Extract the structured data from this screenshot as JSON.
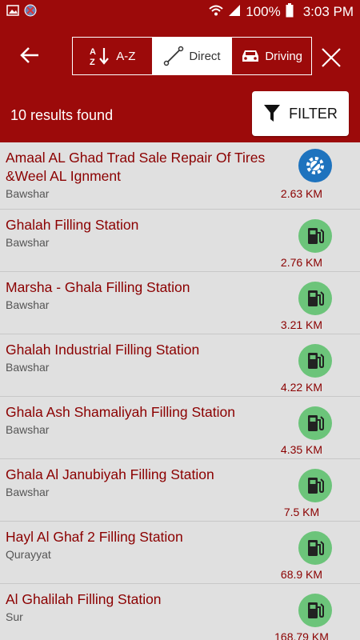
{
  "status_bar": {
    "battery": "100%",
    "time": "3:03 PM"
  },
  "toolbar": {
    "sort_options": [
      {
        "label": "A-Z",
        "icon": "sort-az-icon"
      },
      {
        "label": "Direct",
        "icon": "direct-line-icon"
      },
      {
        "label": "Driving",
        "icon": "car-icon"
      }
    ],
    "active_sort": "Direct"
  },
  "results": {
    "count_text": "10 results found",
    "filter_label": "FILTER"
  },
  "colors": {
    "brand": "#9c0a0a",
    "service_icon": "#1e73be",
    "fuel_icon": "#6cc47a",
    "name_text": "#8b0000"
  },
  "list": [
    {
      "name": "Amaal AL Ghad Trad Sale Repair Of Tires &Weel  AL Ignment",
      "area": "Bawshar",
      "distance": "2.63 KM",
      "icon": "service-gear-icon"
    },
    {
      "name": "Ghalah Filling Station",
      "area": "Bawshar",
      "distance": "2.76 KM",
      "icon": "fuel-pump-icon"
    },
    {
      "name": "Marsha - Ghala Filling Station",
      "area": "Bawshar",
      "distance": "3.21 KM",
      "icon": "fuel-pump-icon"
    },
    {
      "name": "Ghalah Industrial Filling Station",
      "area": "Bawshar",
      "distance": "4.22 KM",
      "icon": "fuel-pump-icon"
    },
    {
      "name": "Ghala Ash Shamaliyah Filling Station",
      "area": "Bawshar",
      "distance": "4.35 KM",
      "icon": "fuel-pump-icon"
    },
    {
      "name": "Ghala Al Janubiyah Filling Station",
      "area": "Bawshar",
      "distance": "7.5 KM",
      "icon": "fuel-pump-icon"
    },
    {
      "name": "Hayl Al Ghaf 2 Filling Station",
      "area": "Qurayyat",
      "distance": "68.9 KM",
      "icon": "fuel-pump-icon"
    },
    {
      "name": "Al Ghalilah Filling Station",
      "area": "Sur",
      "distance": "168.79 KM",
      "icon": "fuel-pump-icon"
    }
  ]
}
